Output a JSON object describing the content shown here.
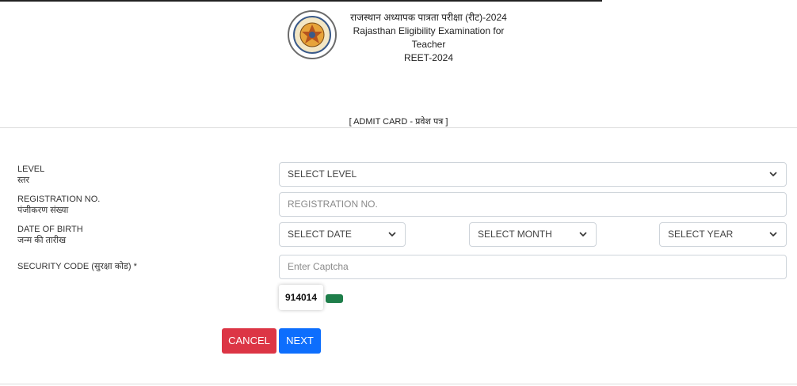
{
  "header": {
    "title_hindi": "राजस्थान अध्यापक पात्रता परीक्षा (रीट)-2024",
    "title_english": "Rajasthan Eligibility Examination for Teacher",
    "title_short": "REET-2024"
  },
  "section_title": "[ ADMIT CARD - प्रवेश पत्र ]",
  "form": {
    "level": {
      "label_en": "LEVEL",
      "label_hi": "स्तर",
      "selected": "SELECT LEVEL"
    },
    "registration": {
      "label_en": "REGISTRATION NO.",
      "label_hi": "पंजीकरण संख्या",
      "placeholder": "REGISTRATION NO."
    },
    "dob": {
      "label_en": "DATE OF BIRTH",
      "label_hi": "जन्म की तारीख",
      "date_selected": "SELECT DATE",
      "month_selected": "SELECT MONTH",
      "year_selected": "SELECT YEAR"
    },
    "security": {
      "label": "SECURITY CODE (सुरक्षा कोड) *",
      "placeholder": "Enter Captcha",
      "captcha_value": "914014"
    }
  },
  "buttons": {
    "cancel": "CANCEL",
    "next": "NEXT"
  },
  "colors": {
    "cancel": "#dc3545",
    "next": "#0d6efd",
    "refresh": "#1e7e4a"
  },
  "icons": {
    "logo": "rajasthan-seal-icon",
    "dropdown": "chevron-down-icon",
    "refresh": "refresh-captcha-icon"
  }
}
